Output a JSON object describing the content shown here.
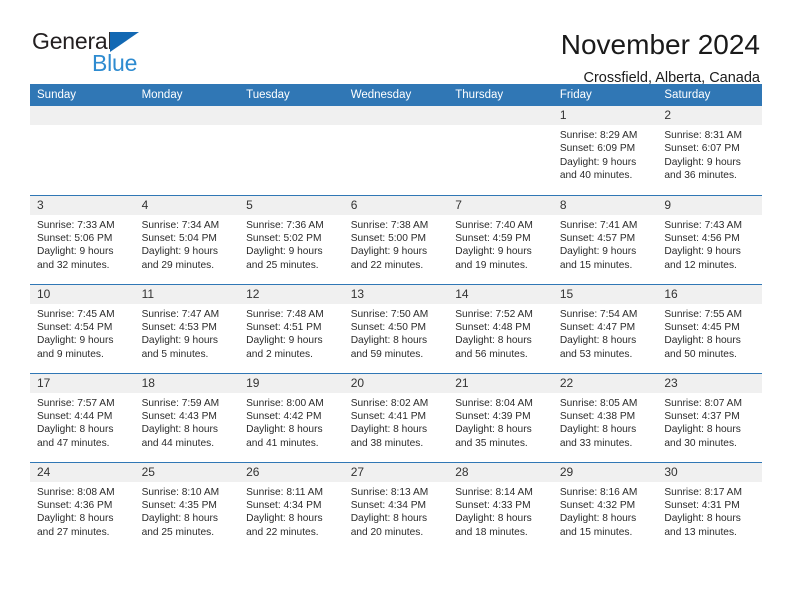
{
  "brand": {
    "name_top": "General",
    "name_bottom": "Blue",
    "accent_color": "#2e8bd0",
    "triangle_color": "#1268b3"
  },
  "header": {
    "title": "November 2024",
    "location": "Crossfield, Alberta, Canada"
  },
  "calendar": {
    "header_bg": "#3077b5",
    "daynum_bg": "#f0f0f0",
    "weekday_names": [
      "Sunday",
      "Monday",
      "Tuesday",
      "Wednesday",
      "Thursday",
      "Friday",
      "Saturday"
    ],
    "labels": {
      "sunrise": "Sunrise:",
      "sunset": "Sunset:",
      "daylight": "Daylight:"
    },
    "weeks": [
      [
        {
          "day": "",
          "empty": true
        },
        {
          "day": "",
          "empty": true
        },
        {
          "day": "",
          "empty": true
        },
        {
          "day": "",
          "empty": true
        },
        {
          "day": "",
          "empty": true
        },
        {
          "day": "1",
          "sunrise": "Sunrise: 8:29 AM",
          "sunset": "Sunset: 6:09 PM",
          "daylight": "Daylight: 9 hours and 40 minutes."
        },
        {
          "day": "2",
          "sunrise": "Sunrise: 8:31 AM",
          "sunset": "Sunset: 6:07 PM",
          "daylight": "Daylight: 9 hours and 36 minutes."
        }
      ],
      [
        {
          "day": "3",
          "sunrise": "Sunrise: 7:33 AM",
          "sunset": "Sunset: 5:06 PM",
          "daylight": "Daylight: 9 hours and 32 minutes."
        },
        {
          "day": "4",
          "sunrise": "Sunrise: 7:34 AM",
          "sunset": "Sunset: 5:04 PM",
          "daylight": "Daylight: 9 hours and 29 minutes."
        },
        {
          "day": "5",
          "sunrise": "Sunrise: 7:36 AM",
          "sunset": "Sunset: 5:02 PM",
          "daylight": "Daylight: 9 hours and 25 minutes."
        },
        {
          "day": "6",
          "sunrise": "Sunrise: 7:38 AM",
          "sunset": "Sunset: 5:00 PM",
          "daylight": "Daylight: 9 hours and 22 minutes."
        },
        {
          "day": "7",
          "sunrise": "Sunrise: 7:40 AM",
          "sunset": "Sunset: 4:59 PM",
          "daylight": "Daylight: 9 hours and 19 minutes."
        },
        {
          "day": "8",
          "sunrise": "Sunrise: 7:41 AM",
          "sunset": "Sunset: 4:57 PM",
          "daylight": "Daylight: 9 hours and 15 minutes."
        },
        {
          "day": "9",
          "sunrise": "Sunrise: 7:43 AM",
          "sunset": "Sunset: 4:56 PM",
          "daylight": "Daylight: 9 hours and 12 minutes."
        }
      ],
      [
        {
          "day": "10",
          "sunrise": "Sunrise: 7:45 AM",
          "sunset": "Sunset: 4:54 PM",
          "daylight": "Daylight: 9 hours and 9 minutes."
        },
        {
          "day": "11",
          "sunrise": "Sunrise: 7:47 AM",
          "sunset": "Sunset: 4:53 PM",
          "daylight": "Daylight: 9 hours and 5 minutes."
        },
        {
          "day": "12",
          "sunrise": "Sunrise: 7:48 AM",
          "sunset": "Sunset: 4:51 PM",
          "daylight": "Daylight: 9 hours and 2 minutes."
        },
        {
          "day": "13",
          "sunrise": "Sunrise: 7:50 AM",
          "sunset": "Sunset: 4:50 PM",
          "daylight": "Daylight: 8 hours and 59 minutes."
        },
        {
          "day": "14",
          "sunrise": "Sunrise: 7:52 AM",
          "sunset": "Sunset: 4:48 PM",
          "daylight": "Daylight: 8 hours and 56 minutes."
        },
        {
          "day": "15",
          "sunrise": "Sunrise: 7:54 AM",
          "sunset": "Sunset: 4:47 PM",
          "daylight": "Daylight: 8 hours and 53 minutes."
        },
        {
          "day": "16",
          "sunrise": "Sunrise: 7:55 AM",
          "sunset": "Sunset: 4:45 PM",
          "daylight": "Daylight: 8 hours and 50 minutes."
        }
      ],
      [
        {
          "day": "17",
          "sunrise": "Sunrise: 7:57 AM",
          "sunset": "Sunset: 4:44 PM",
          "daylight": "Daylight: 8 hours and 47 minutes."
        },
        {
          "day": "18",
          "sunrise": "Sunrise: 7:59 AM",
          "sunset": "Sunset: 4:43 PM",
          "daylight": "Daylight: 8 hours and 44 minutes."
        },
        {
          "day": "19",
          "sunrise": "Sunrise: 8:00 AM",
          "sunset": "Sunset: 4:42 PM",
          "daylight": "Daylight: 8 hours and 41 minutes."
        },
        {
          "day": "20",
          "sunrise": "Sunrise: 8:02 AM",
          "sunset": "Sunset: 4:41 PM",
          "daylight": "Daylight: 8 hours and 38 minutes."
        },
        {
          "day": "21",
          "sunrise": "Sunrise: 8:04 AM",
          "sunset": "Sunset: 4:39 PM",
          "daylight": "Daylight: 8 hours and 35 minutes."
        },
        {
          "day": "22",
          "sunrise": "Sunrise: 8:05 AM",
          "sunset": "Sunset: 4:38 PM",
          "daylight": "Daylight: 8 hours and 33 minutes."
        },
        {
          "day": "23",
          "sunrise": "Sunrise: 8:07 AM",
          "sunset": "Sunset: 4:37 PM",
          "daylight": "Daylight: 8 hours and 30 minutes."
        }
      ],
      [
        {
          "day": "24",
          "sunrise": "Sunrise: 8:08 AM",
          "sunset": "Sunset: 4:36 PM",
          "daylight": "Daylight: 8 hours and 27 minutes."
        },
        {
          "day": "25",
          "sunrise": "Sunrise: 8:10 AM",
          "sunset": "Sunset: 4:35 PM",
          "daylight": "Daylight: 8 hours and 25 minutes."
        },
        {
          "day": "26",
          "sunrise": "Sunrise: 8:11 AM",
          "sunset": "Sunset: 4:34 PM",
          "daylight": "Daylight: 8 hours and 22 minutes."
        },
        {
          "day": "27",
          "sunrise": "Sunrise: 8:13 AM",
          "sunset": "Sunset: 4:34 PM",
          "daylight": "Daylight: 8 hours and 20 minutes."
        },
        {
          "day": "28",
          "sunrise": "Sunrise: 8:14 AM",
          "sunset": "Sunset: 4:33 PM",
          "daylight": "Daylight: 8 hours and 18 minutes."
        },
        {
          "day": "29",
          "sunrise": "Sunrise: 8:16 AM",
          "sunset": "Sunset: 4:32 PM",
          "daylight": "Daylight: 8 hours and 15 minutes."
        },
        {
          "day": "30",
          "sunrise": "Sunrise: 8:17 AM",
          "sunset": "Sunset: 4:31 PM",
          "daylight": "Daylight: 8 hours and 13 minutes."
        }
      ]
    ]
  }
}
